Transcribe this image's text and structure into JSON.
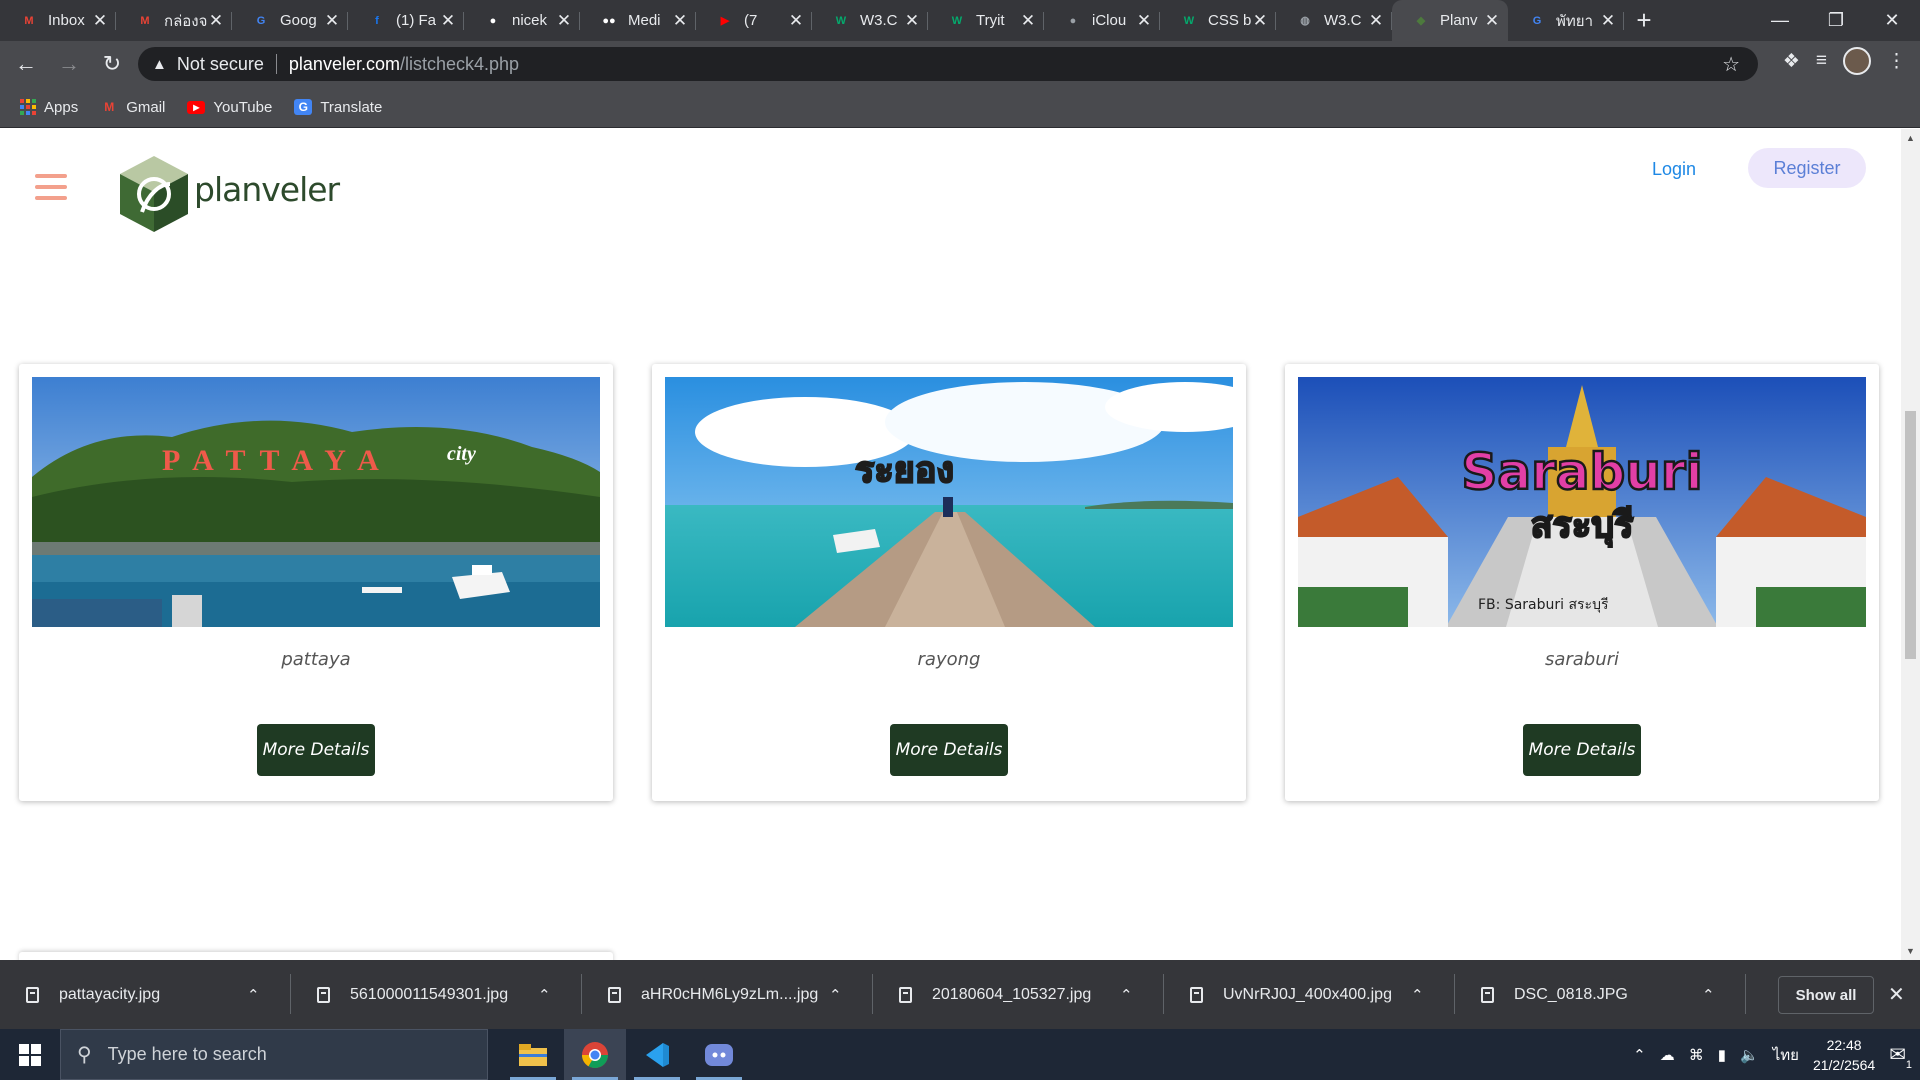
{
  "browser": {
    "tabs": [
      {
        "label": "Inbox",
        "icon": "gmail-icon",
        "color": "#ea4335",
        "glyph": "M"
      },
      {
        "label": "กล่องจ",
        "icon": "gmail-icon",
        "color": "#ea4335",
        "glyph": "M"
      },
      {
        "label": "Goog",
        "icon": "google-translate-icon",
        "color": "#4285f4",
        "glyph": "G"
      },
      {
        "label": "(1) Fa",
        "icon": "facebook-icon",
        "color": "#1877f2",
        "glyph": "f"
      },
      {
        "label": "nicek",
        "icon": "github-icon",
        "color": "#ffffff",
        "glyph": "●"
      },
      {
        "label": "Medi",
        "icon": "medium-icon",
        "color": "#ffffff",
        "glyph": "●●"
      },
      {
        "label": "(7",
        "icon": "youtube-icon",
        "color": "#ff0000",
        "glyph": "▶"
      },
      {
        "label": "W3.C",
        "icon": "w3schools-icon",
        "color": "#04aa6d",
        "glyph": "W"
      },
      {
        "label": "Tryit",
        "icon": "w3schools-icon",
        "color": "#04aa6d",
        "glyph": "W"
      },
      {
        "label": "iClou",
        "icon": "apple-icon",
        "color": "#9aa0a6",
        "glyph": "●"
      },
      {
        "label": "CSS b",
        "icon": "w3schools-icon",
        "color": "#04aa6d",
        "glyph": "W"
      },
      {
        "label": "W3.C",
        "icon": "globe-icon",
        "color": "#9aa0a6",
        "glyph": "◍"
      },
      {
        "label": "Planv",
        "icon": "planveler-icon",
        "color": "#4d7a3d",
        "glyph": "◆",
        "active": true
      },
      {
        "label": "พัทยา",
        "icon": "google-icon",
        "color": "#4285f4",
        "glyph": "G"
      }
    ],
    "url": {
      "security": "Not secure",
      "host": "planveler.com",
      "path": "/listcheck4.php"
    },
    "bookmarks": [
      {
        "label": "Apps",
        "icon": "apps-grid-icon"
      },
      {
        "label": "Gmail",
        "icon": "gmail-icon"
      },
      {
        "label": "YouTube",
        "icon": "youtube-icon"
      },
      {
        "label": "Translate",
        "icon": "google-translate-icon"
      }
    ]
  },
  "site": {
    "brand": "planveler",
    "nav": {
      "login": "Login",
      "register": "Register"
    },
    "cards": [
      {
        "name": "pattaya",
        "button": "More Details",
        "image_text": "PATTAYA",
        "image_text2": "city"
      },
      {
        "name": "rayong",
        "button": "More Details",
        "image_text": "ระยอง"
      },
      {
        "name": "saraburi",
        "button": "More Details",
        "image_text": "Saraburi",
        "image_text2": "สระบุรี",
        "image_caption": "FB: Saraburi สระบุรี"
      }
    ]
  },
  "downloads": {
    "items": [
      "pattayacity.jpg",
      "561000011549301.jpg",
      "aHR0cHM6Ly9zLm....jpg",
      "20180604_105327.jpg",
      "UvNrRJ0J_400x400.jpg",
      "DSC_0818.JPG"
    ],
    "show_all": "Show all"
  },
  "taskbar": {
    "search_placeholder": "Type here to search",
    "language": "ไทย",
    "time": "22:48",
    "date": "21/2/2564",
    "notification_count": "1"
  }
}
